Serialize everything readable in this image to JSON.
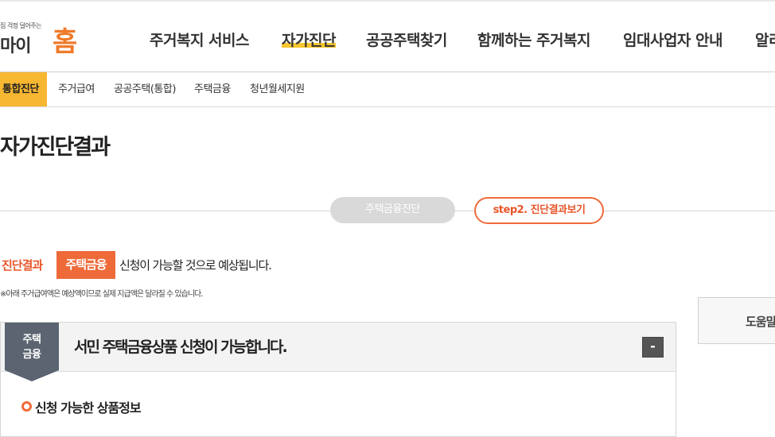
{
  "logo": {
    "tagline": "집 걱정 덜어주는",
    "main": "마이",
    "accent": "홈"
  },
  "gnb": {
    "items": [
      {
        "label": "주거복지 서비스"
      },
      {
        "label": "자가진단"
      },
      {
        "label": "공공주택찾기"
      },
      {
        "label": "함께하는 주거복지"
      },
      {
        "label": "임대사업자 안내"
      },
      {
        "label": "알리"
      }
    ],
    "active_index": 1
  },
  "subnav": {
    "items": [
      {
        "label": "통합진단"
      },
      {
        "label": "주거급여"
      },
      {
        "label": "공공주택(통합)"
      },
      {
        "label": "주택금융"
      },
      {
        "label": "청년월세지원"
      }
    ]
  },
  "page": {
    "title": "자가진단결과"
  },
  "steps": {
    "step1": "주택금융진단",
    "step2": "step2. 진단결과보기"
  },
  "result": {
    "label": "진단결과",
    "badge": "주택금융",
    "text": "신청이 가능할 것으로 예상됩니다.",
    "note": "※아래 주거급여액은 예상액이므로 실제 지급액은 달라질 수 있습니다."
  },
  "help": {
    "label": "도움말"
  },
  "panel": {
    "ribbon_line1": "주택",
    "ribbon_line2": "금융",
    "title": "서민 주택금융상품 신청이 가능합니다.",
    "collapse_label": "-",
    "section_title": "신청 가능한 상품정보"
  },
  "colors": {
    "accent": "#ee6a39",
    "highlight": "#f7c630",
    "subnav_active": "#f7b731",
    "ribbon": "#5b6470"
  }
}
